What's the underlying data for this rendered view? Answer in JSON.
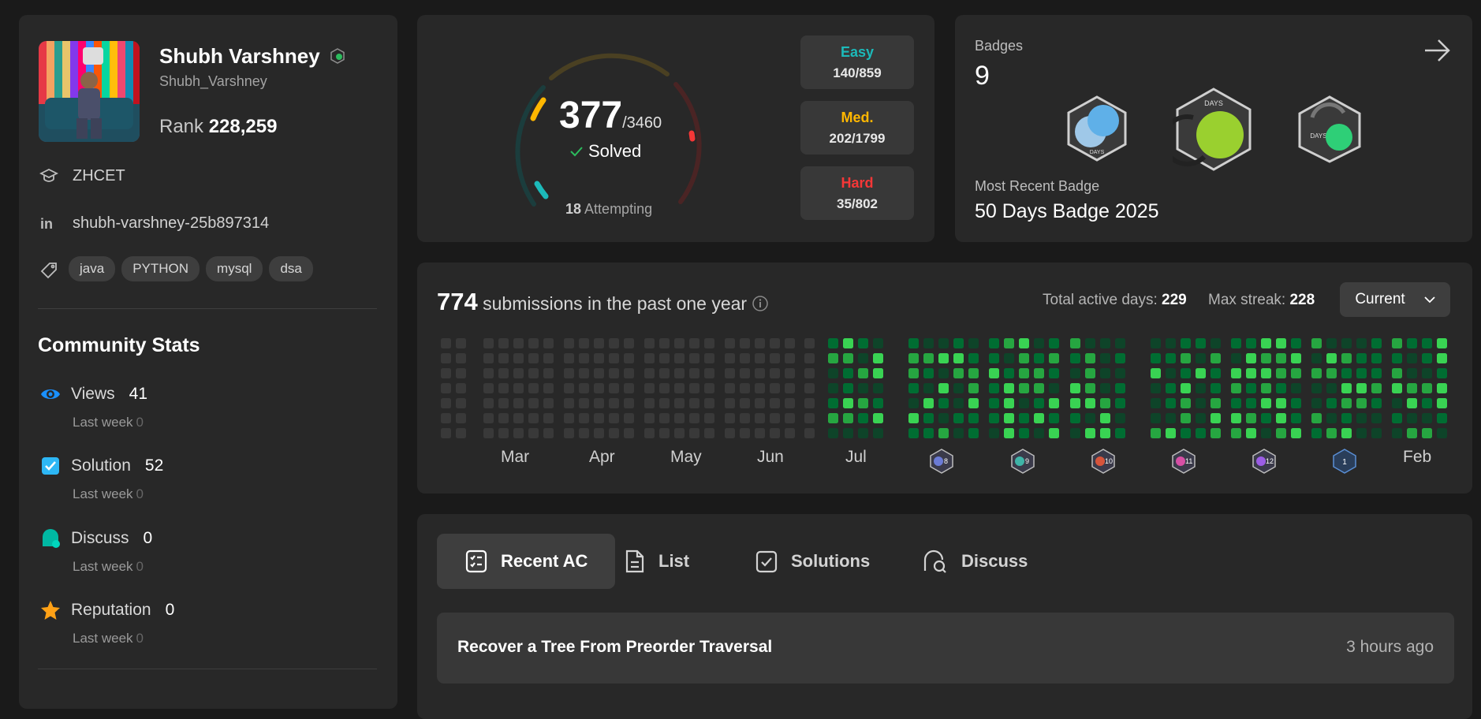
{
  "profile": {
    "name": "Shubh Varshney",
    "username": "Shubh_Varshney",
    "rank_label": "Rank",
    "rank_value": "228,259",
    "school": "ZHCET",
    "linkedin": "shubh-varshney-25b897314",
    "tags": [
      "java",
      "PYTHON",
      "mysql",
      "dsa"
    ]
  },
  "community": {
    "title": "Community Stats",
    "stats": [
      {
        "label": "Views",
        "value": "41",
        "sub_label": "Last week",
        "sub_value": "0",
        "icon": "eye-icon",
        "color": "#1a90ff"
      },
      {
        "label": "Solution",
        "value": "52",
        "sub_label": "Last week",
        "sub_value": "0",
        "icon": "checkbox-icon",
        "color": "#2db7f5"
      },
      {
        "label": "Discuss",
        "value": "0",
        "sub_label": "Last week",
        "sub_value": "0",
        "icon": "chat-icon",
        "color": "#00b8a3"
      },
      {
        "label": "Reputation",
        "value": "0",
        "sub_label": "Last week",
        "sub_value": "0",
        "icon": "star-icon",
        "color": "#ffa116"
      }
    ]
  },
  "solved": {
    "count": "377",
    "total": "/3460",
    "solved_label": "Solved",
    "attempting_count": "18",
    "attempting_label": "Attempting",
    "difficulties": [
      {
        "label": "Easy",
        "value": "140/859",
        "color": "#1cbaba"
      },
      {
        "label": "Med.",
        "value": "202/1799",
        "color": "#ffb700"
      },
      {
        "label": "Hard",
        "value": "35/802",
        "color": "#f63737"
      }
    ]
  },
  "badges": {
    "label": "Badges",
    "count": "9",
    "recent_label": "Most Recent Badge",
    "recent_name": "50 Days Badge 2025",
    "badge_text": "DAYS"
  },
  "submissions": {
    "count": "774",
    "text": "submissions in the past one year",
    "active_days_label": "Total active days:",
    "active_days": "229",
    "max_streak_label": "Max streak:",
    "max_streak": "228",
    "selector": "Current",
    "months": [
      "Mar",
      "Apr",
      "May",
      "Jun",
      "Jul",
      "Feb"
    ],
    "month_badges": [
      "8",
      "9",
      "10",
      "11",
      "12",
      "1"
    ]
  },
  "recent": {
    "tabs": [
      {
        "label": "Recent AC",
        "icon": "list-check-icon"
      },
      {
        "label": "List",
        "icon": "document-icon"
      },
      {
        "label": "Solutions",
        "icon": "check-square-icon"
      },
      {
        "label": "Discuss",
        "icon": "discuss-icon"
      }
    ],
    "items": [
      {
        "title": "Recover a Tree From Preorder Traversal",
        "time": "3 hours ago"
      }
    ]
  },
  "colors": {
    "accent_green_1": "#0e4429",
    "accent_green_2": "#006d32",
    "accent_green_3": "#26a641",
    "accent_green_4": "#39d353",
    "empty_cell": "#393939"
  }
}
